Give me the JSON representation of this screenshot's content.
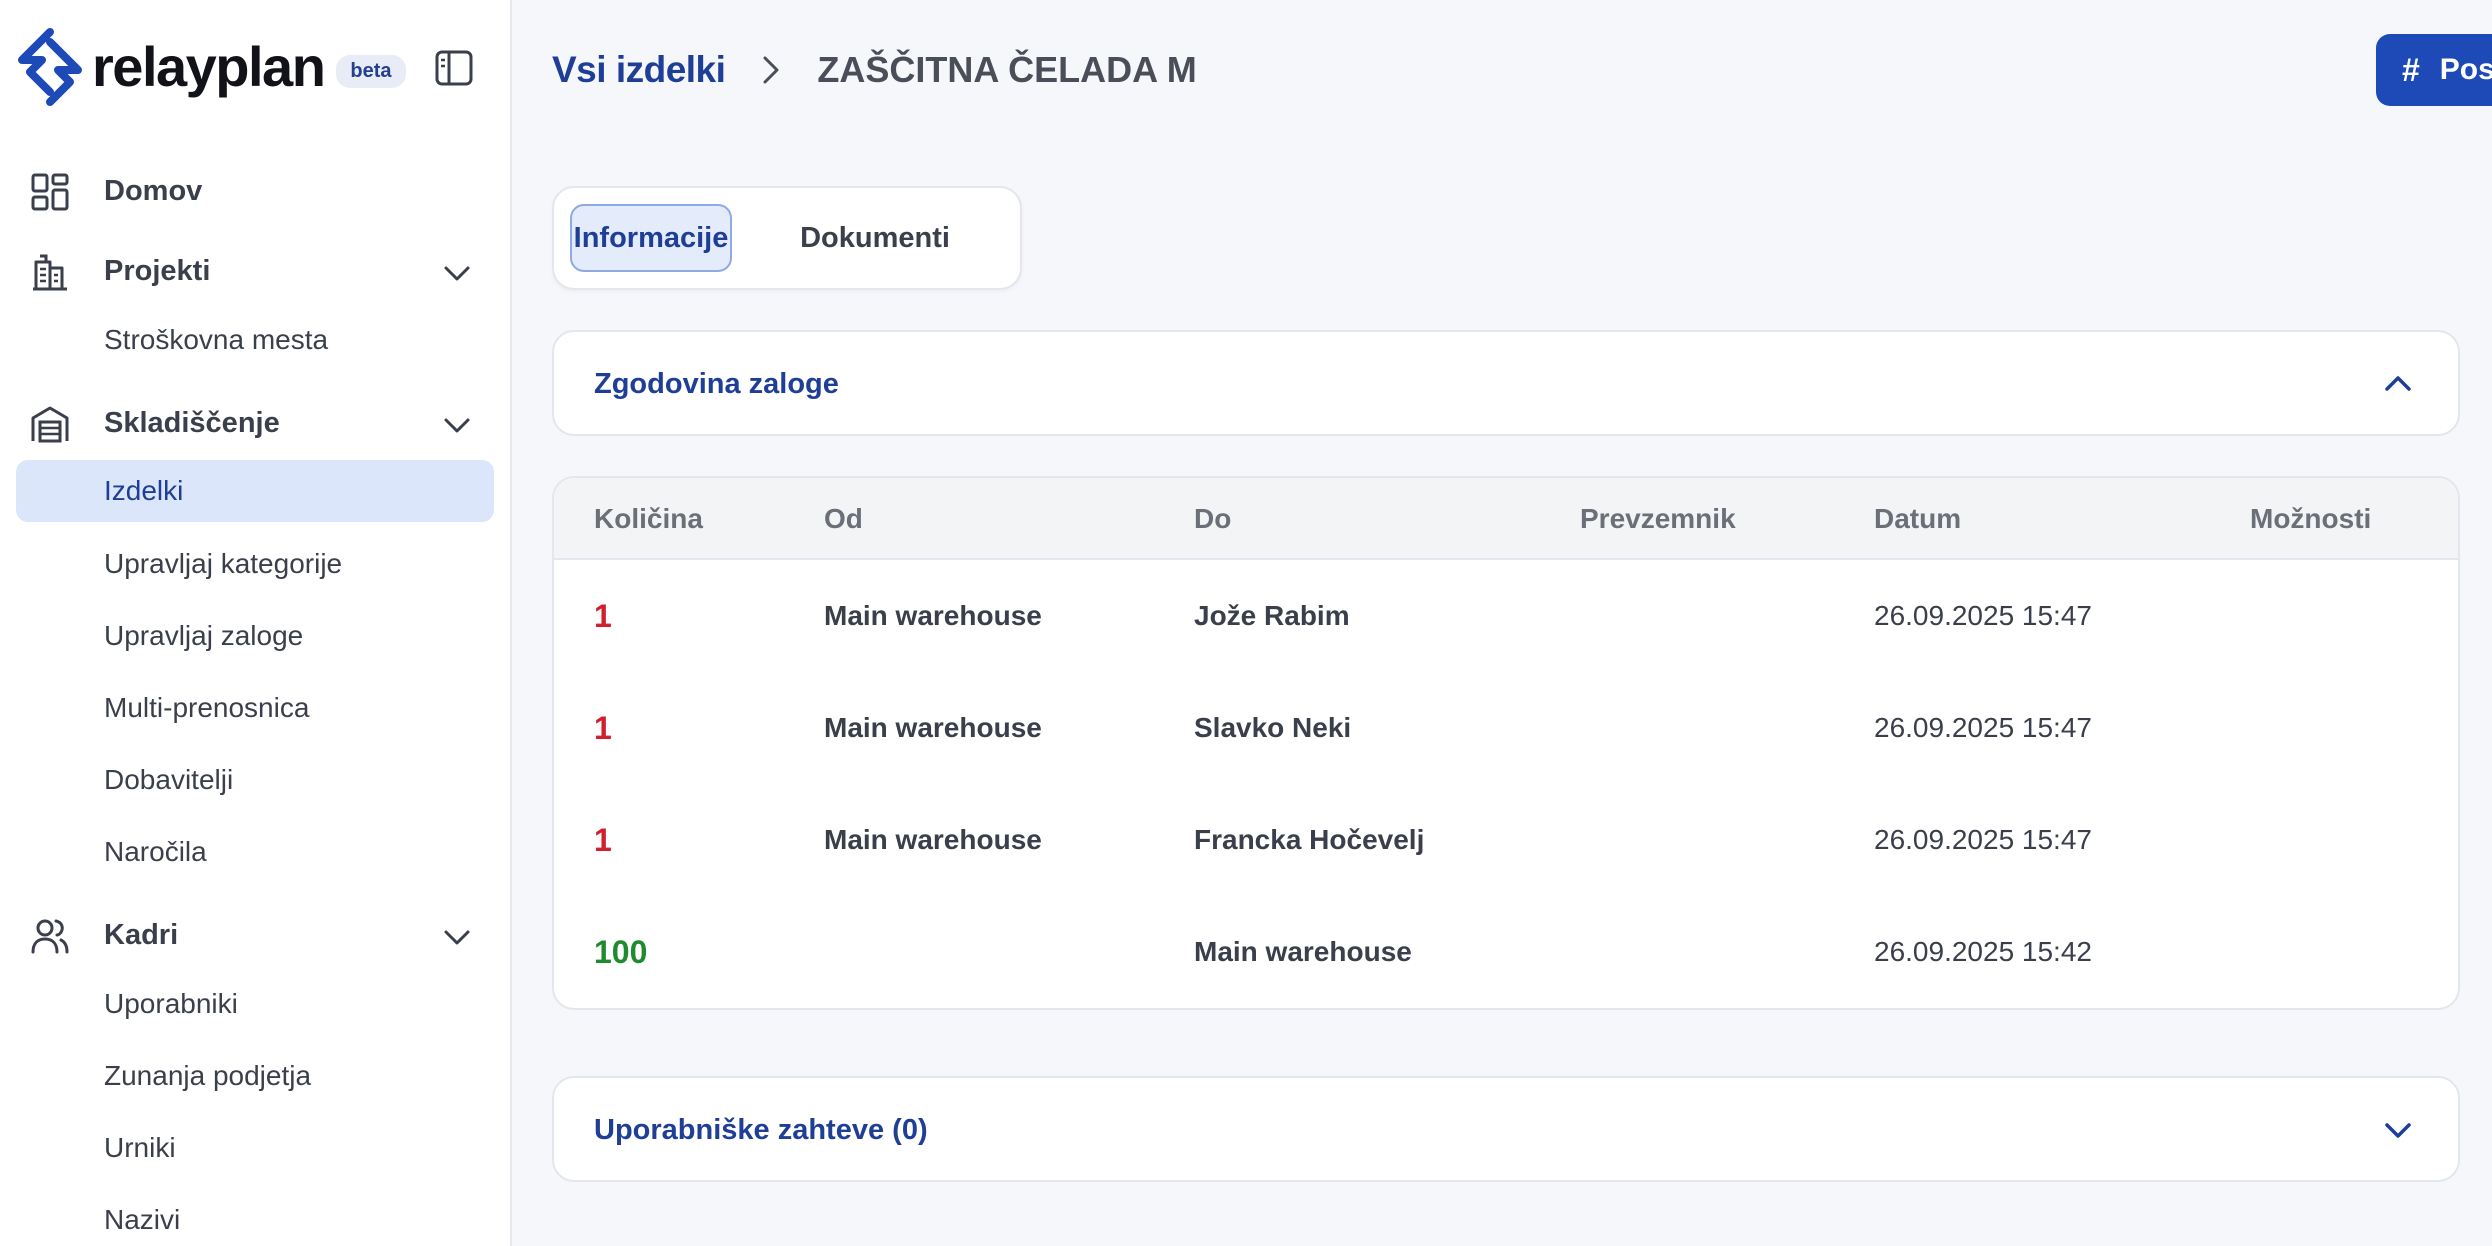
{
  "brand": {
    "name": "relayplan",
    "badge": "beta",
    "color": "#1e4ab8"
  },
  "sidebar": {
    "sections": [
      {
        "label": "Domov",
        "icon": "dashboard-grid-icon"
      },
      {
        "label": "Projekti",
        "icon": "building-icon",
        "expandable": true,
        "items": [
          "Stroškovna mesta"
        ]
      },
      {
        "label": "Skladiščenje",
        "icon": "warehouse-icon",
        "expandable": true,
        "items": [
          "Izdelki",
          "Upravljaj kategorije",
          "Upravljaj zaloge",
          "Multi-prenosnica",
          "Dobavitelji",
          "Naročila"
        ],
        "active_item": "Izdelki"
      },
      {
        "label": "Kadri",
        "icon": "users-icon",
        "expandable": true,
        "items": [
          "Uporabniki",
          "Zunanja podjetja",
          "Urniki",
          "Nazivi"
        ]
      }
    ]
  },
  "header": {
    "breadcrumb_root": "Vsi izdelki",
    "breadcrumb_current": "ZAŠČITNA ČELADA M",
    "action_button": {
      "icon": "#",
      "label": "Pos"
    }
  },
  "tabs": {
    "active": "Informacije",
    "inactive": "Dokumenti"
  },
  "stock_history": {
    "title": "Zgodovina zaloge",
    "expanded": true,
    "columns": [
      "Količina",
      "Od",
      "Do",
      "Prevzemnik",
      "Datum",
      "Možnosti"
    ],
    "rows": [
      {
        "qty": "1",
        "qty_color": "#d0202e",
        "from": "Main warehouse",
        "to": "Jože Rabim",
        "receiver": "",
        "date": "26.09.2025 15:47"
      },
      {
        "qty": "1",
        "qty_color": "#d0202e",
        "from": "Main warehouse",
        "to": "Slavko Neki",
        "receiver": "",
        "date": "26.09.2025 15:47"
      },
      {
        "qty": "1",
        "qty_color": "#d0202e",
        "from": "Main warehouse",
        "to": "Francka Hočevelj",
        "receiver": "",
        "date": "26.09.2025 15:47"
      },
      {
        "qty": "100",
        "qty_color": "#1f8a2e",
        "from": "",
        "to": "Main warehouse",
        "receiver": "",
        "date": "26.09.2025 15:42"
      }
    ]
  },
  "user_requests": {
    "title": "Uporabniške zahteve (0)",
    "expanded": false
  },
  "colors": {
    "accent": "#1e3f95",
    "active_bg": "#dbe6fb",
    "button": "#1e4ab8"
  }
}
